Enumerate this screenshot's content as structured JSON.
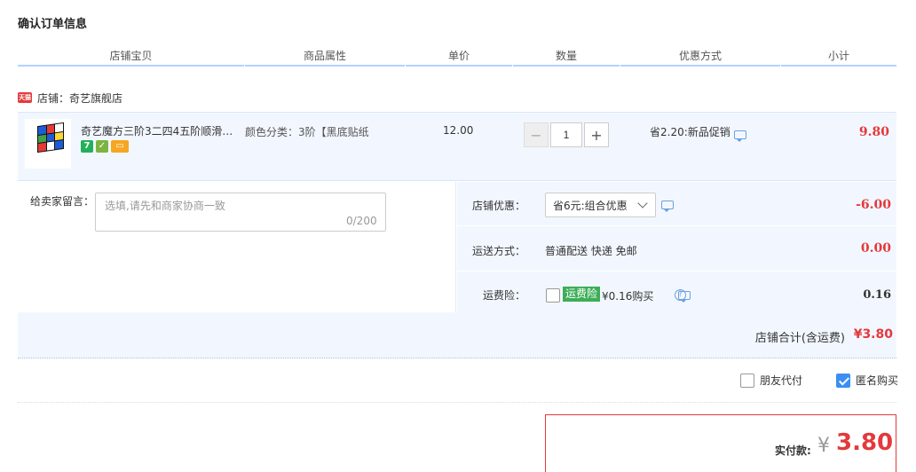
{
  "page_title": "确认订单信息",
  "columns": [
    "店铺宝贝",
    "商品属性",
    "单价",
    "数量",
    "优惠方式",
    "小计"
  ],
  "shop": {
    "badge": "天猫",
    "name": "店铺：奇艺旗舰店"
  },
  "item": {
    "name": "奇艺魔方三阶3二四4五阶顺滑…",
    "attr": "颜色分类：3阶【黑底贴纸",
    "unit_price": "12.00",
    "quantity": "1",
    "promo": "省2.20:新品促销",
    "subtotal": "9.80",
    "badges": [
      "7"
    ]
  },
  "message": {
    "label": "给卖家留言：",
    "placeholder": "选填,请先和商家协商一致",
    "count": "0/200"
  },
  "shop_discount": {
    "label": "店铺优惠：",
    "selected": "省6元:组合优惠",
    "value": "-6.00"
  },
  "shipping": {
    "label": "运送方式：",
    "method": "普通配送 快递 免邮",
    "value": "0.00"
  },
  "insurance": {
    "label": "运费险：",
    "tag": "运费险",
    "price": "¥0.16购买",
    "value": "0.16"
  },
  "shop_total": {
    "label": "店铺合计(含运费)",
    "value": "¥3.80"
  },
  "options": {
    "friend_pay": "朋友代付",
    "anonymous": "匿名购买",
    "anonymous_checked": true
  },
  "payment": {
    "label": "实付款:",
    "currency": "¥",
    "amount": "3.80"
  },
  "colors": {
    "accent_red": "#e4393c",
    "light_blue_bg": "#f2f7ff",
    "header_line": "#b2d1ff",
    "checkbox_blue": "#3c8ef3"
  },
  "icons": {
    "minus": "−",
    "plus": "+",
    "help": "?"
  }
}
